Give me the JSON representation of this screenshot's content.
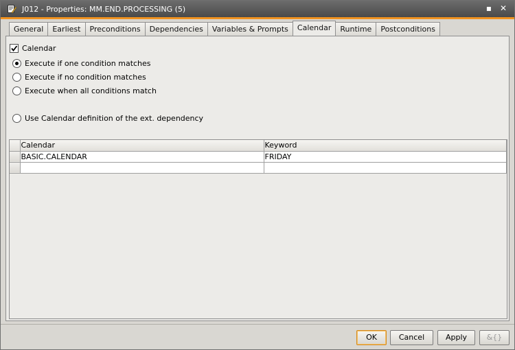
{
  "window": {
    "title": "J012 - Properties: MM.END.PROCESSING (5)",
    "minimize_glyph": "▪",
    "close_glyph": "✕"
  },
  "tabs": [
    {
      "label": "General"
    },
    {
      "label": "Earliest"
    },
    {
      "label": "Preconditions"
    },
    {
      "label": "Dependencies"
    },
    {
      "label": "Variables & Prompts"
    },
    {
      "label": "Calendar",
      "active": true
    },
    {
      "label": "Runtime"
    },
    {
      "label": "Postconditions"
    }
  ],
  "calendar": {
    "enable_label": "Calendar",
    "enabled": true,
    "options": [
      {
        "label": "Execute if one condition matches",
        "checked": true
      },
      {
        "label": "Execute if no condition matches",
        "checked": false
      },
      {
        "label": "Execute when all conditions match",
        "checked": false
      },
      {
        "label": "Use Calendar definition of the ext. dependency",
        "checked": false
      }
    ]
  },
  "grid": {
    "columns": [
      "Calendar",
      "Keyword"
    ],
    "rows": [
      [
        "BASIC.CALENDAR",
        "FRIDAY"
      ],
      [
        "",
        ""
      ]
    ]
  },
  "buttons": {
    "ok": "OK",
    "cancel": "Cancel",
    "apply": "Apply",
    "extra_glyph": "&{}"
  },
  "colors": {
    "accent": "#f0921f",
    "titlebar": "#5a5a5a"
  }
}
